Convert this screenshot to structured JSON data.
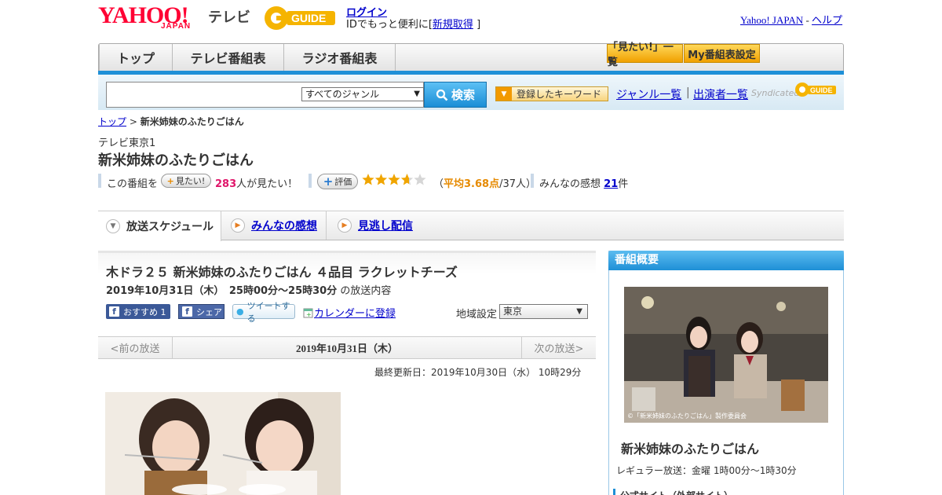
{
  "header": {
    "logo_yahoo": "YAHOO!",
    "logo_japan": "JAPAN",
    "logo_tv": "テレビ",
    "login_label": "ログイン",
    "login_desc": "IDでもっと便利に[",
    "signup_label": "新規取得",
    "login_desc_end": "]",
    "yahoo_japan_label": "Yahoo! JAPAN",
    "separator": "-",
    "help_label": "ヘルプ"
  },
  "nav": {
    "tabs": [
      {
        "label": "トップ"
      },
      {
        "label": "テレビ番組表"
      },
      {
        "label": "ラジオ番組表"
      }
    ],
    "mitai_list_label": "「見たい!」一覧",
    "my_schedule_label": "My番組表設定"
  },
  "search": {
    "input_value": "",
    "genre_selected": "すべてのジャンル",
    "search_label": "検索",
    "keyword_label": "登録したキーワード",
    "genre_list_label": "ジャンル一覧",
    "separator": "|",
    "cast_list_label": "出演者一覧",
    "syndicated_label": "Syndicated"
  },
  "breadcrumb": {
    "top_label": "トップ",
    "separator": ">",
    "current": "新米姉妹のふたりごはん"
  },
  "program": {
    "channel": "テレビ東京1",
    "title": "新米姉妹のふたりごはん",
    "stat_prefix": "この番組を",
    "mitai_button": "見たい!",
    "mitai_count": "283",
    "mitai_suffix": "人が見たい！",
    "hyoka_button": "評価",
    "rating_value": 3.68,
    "rating_open": "（",
    "rating_text": "平均3.68点",
    "rating_people": "/37人）",
    "kanso_prefix": "みんなの感想",
    "kanso_count": "21",
    "kanso_suffix": "件"
  },
  "tabs": {
    "schedule": "放送スケジュール",
    "kanso": "みんなの感想",
    "minogashi": "見逃し配信"
  },
  "episode": {
    "title": "木ドラ２５ 新米姉妹のふたりごはん ４品目 ラクレットチーズ",
    "date": "2019年10月31日（木）　25時00分～25時30分",
    "date_suffix": "の放送内容",
    "fb_recommend": "おすすめ 1",
    "fb_share": "シェア",
    "tweet": "ツイートする",
    "calendar": "カレンダーに登録",
    "region_label": "地域設定",
    "region_selected": "東京"
  },
  "pager": {
    "prev": "<前の放送",
    "date": "2019年10月31日（木）",
    "next": "次の放送>",
    "updated": "最終更新日：2019年10月30日（水） 10時29分"
  },
  "sidebar": {
    "heading": "番組概要",
    "image_caption": "©「新米姉妹のふたりごはん」製作委員会",
    "title": "新米姉妹のふたりごはん",
    "regular": "レギュラー放送：金曜 1時00分～1時30分",
    "official_label": "公式サイト（外部サイト）"
  }
}
